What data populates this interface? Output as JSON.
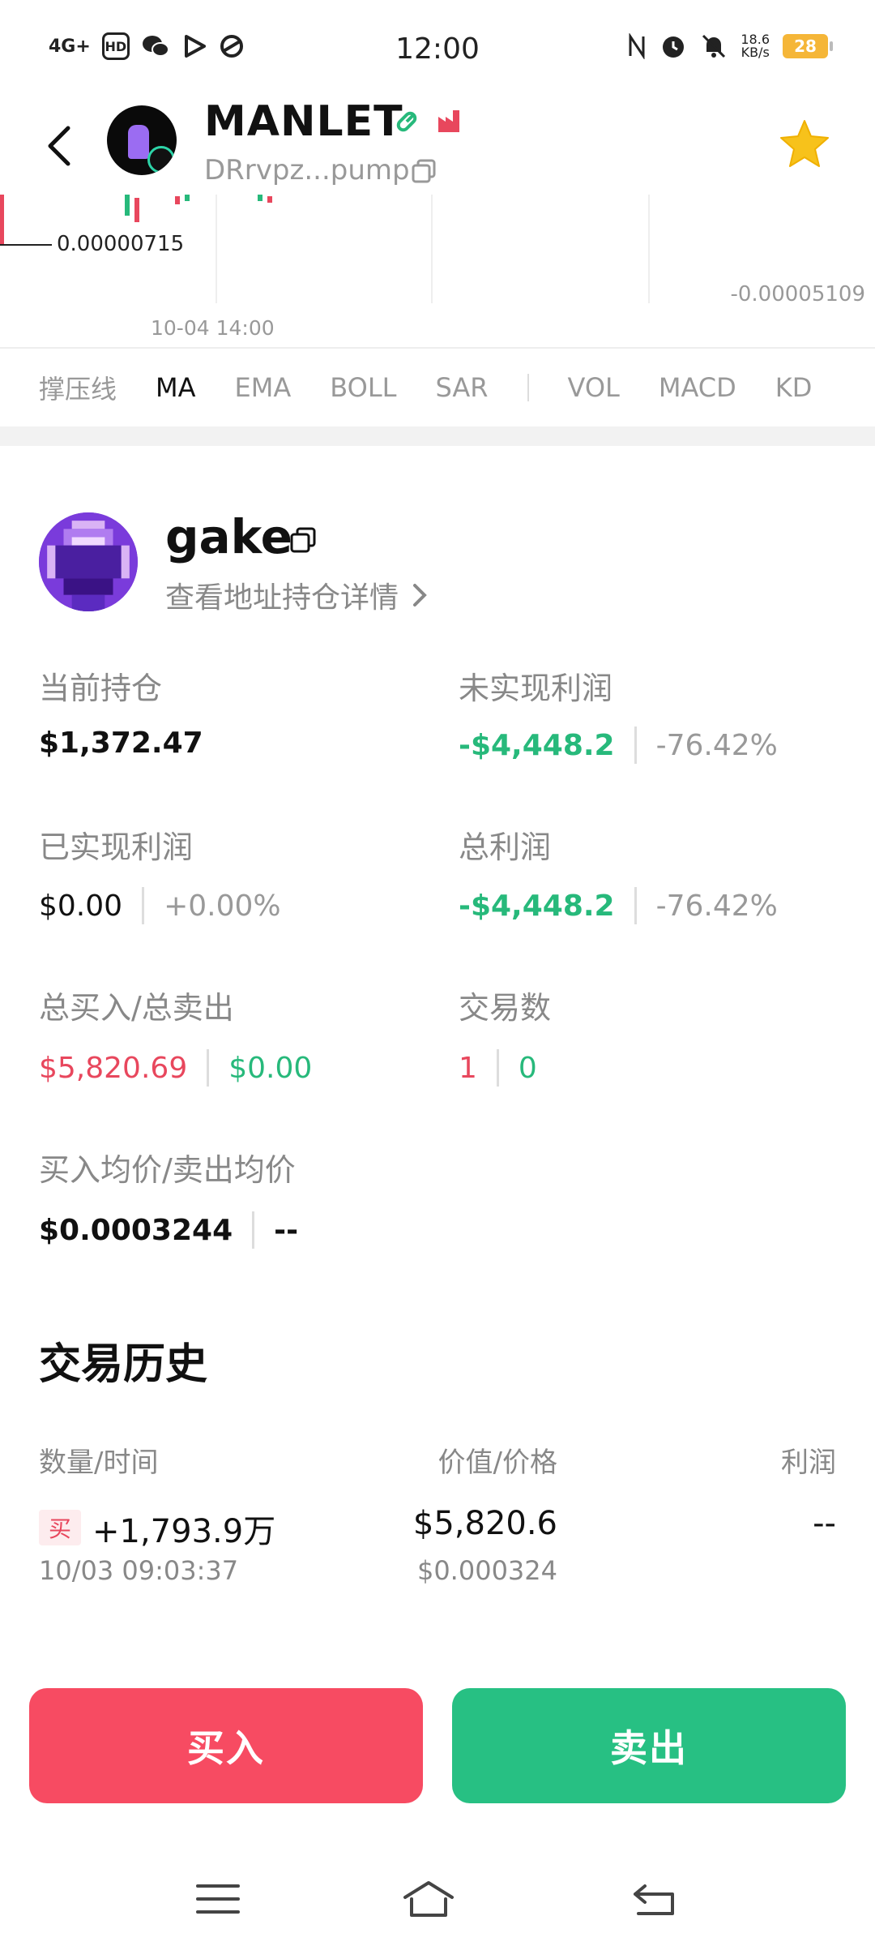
{
  "status_bar": {
    "network": "4G+",
    "hd": "HD",
    "time": "12:00",
    "speed_value": "18.6",
    "speed_unit": "KB/s",
    "battery": "28"
  },
  "token": {
    "name": "MANLET",
    "address": "DRrvpz...pump"
  },
  "chart": {
    "price_label": "0.00000715",
    "right_label": "-0.00005109",
    "time_label": "10-04 14:00"
  },
  "indicators": [
    "撑压线",
    "MA",
    "EMA",
    "BOLL",
    "SAR",
    "VOL",
    "MACD",
    "KD"
  ],
  "user": {
    "name": "gake",
    "link": "查看地址持仓详情"
  },
  "stats": {
    "holding_label": "当前持仓",
    "holding_value": "$1,372.47",
    "unrealized_label": "未实现利润",
    "unrealized_value": "-$4,448.2",
    "unrealized_pct": "-76.42%",
    "realized_label": "已实现利润",
    "realized_value": "$0.00",
    "realized_pct": "+0.00%",
    "total_label": "总利润",
    "total_value": "-$4,448.2",
    "total_pct": "-76.42%",
    "buysell_label": "总买入/总卖出",
    "total_buy": "$5,820.69",
    "total_sell": "$0.00",
    "trades_label": "交易数",
    "trades_buy": "1",
    "trades_sell": "0",
    "avg_label": "买入均价/卖出均价",
    "avg_buy": "$0.0003244",
    "avg_sell": "--"
  },
  "history": {
    "title": "交易历史",
    "col_qty": "数量/时间",
    "col_value": "价值/价格",
    "col_profit": "利润",
    "rows": [
      {
        "tag": "买",
        "qty": "+1,793.9万",
        "time": "10/03 09:03:37",
        "value": "$5,820.6",
        "price": "$0.000324",
        "profit": "--"
      }
    ]
  },
  "actions": {
    "buy": "买入",
    "sell": "卖出"
  },
  "colors": {
    "buy": "#f74b62",
    "sell": "#27c083",
    "negative": "#27b97b",
    "positive": "#e8475d",
    "star": "#f7c21b"
  }
}
